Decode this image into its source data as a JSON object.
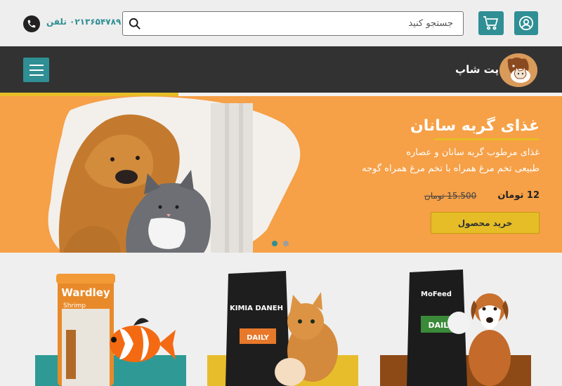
{
  "header": {
    "phone_label": "۰۲۱۳۶۵۴۷۸۹ تلفن",
    "search_placeholder": "جستجو کنید"
  },
  "nav": {
    "brand": "پت شاپ"
  },
  "hero": {
    "title": "غذای گربه سانان",
    "description_line1": "غذای مرطوب گربه سانان و عصاره",
    "description_line2": "طبیعی تخم مرغ همراه با تخم مرغ همراه گوجه",
    "price_new": "12 تومان",
    "price_old": "15.500 تومان",
    "buy_label": "خرید محصول",
    "slide_count": 2,
    "active_slide": 1
  },
  "products": [
    {
      "brand": "Wardley",
      "subtitle": "Shrimp",
      "accent": "#2f9a95"
    },
    {
      "brand": "KIMIA DANEH",
      "subtitle": "DAILY",
      "accent": "#e8bd2c"
    },
    {
      "brand": "MoFeed",
      "subtitle": "DAILY",
      "accent": "#8d4a17"
    }
  ],
  "colors": {
    "accent_teal": "#2f8f94",
    "accent_yellow": "#e6bd26",
    "hero_orange": "#f6a047",
    "navbar_dark": "#323232"
  },
  "icons": {
    "user": "user-circle-icon",
    "cart": "cart-icon",
    "search": "search-icon",
    "phone": "phone-icon",
    "menu": "hamburger-menu-icon"
  }
}
